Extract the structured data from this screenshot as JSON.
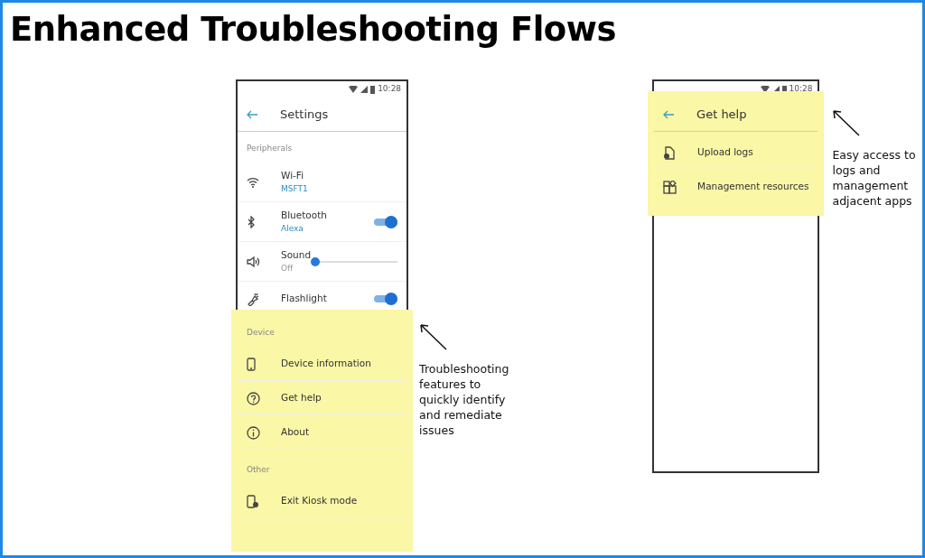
{
  "title": "Enhanced Troubleshooting Flows",
  "phones": [
    {
      "status_time": "10:28",
      "blocks": [
        {
          "kind": "header",
          "title": "Settings",
          "highlighted": false
        },
        {
          "kind": "section",
          "label": "Peripherals",
          "highlighted": false,
          "items": [
            {
              "kind": "text",
              "label": "Wi-Fi",
              "subtitle": "MSFT1",
              "accent": true
            },
            {
              "kind": "toggle",
              "label": "Bluetooth",
              "subtitle": "Alexa",
              "accent": true,
              "on": true
            },
            {
              "kind": "slider",
              "label": "Sound",
              "subtitle": "Off",
              "accent": false,
              "level": 0
            },
            {
              "kind": "toggle",
              "label": "Flashlight",
              "on": true
            }
          ]
        },
        {
          "kind": "section",
          "label": "Device",
          "highlighted": true,
          "items": [
            {
              "kind": "text",
              "label": "Device information"
            },
            {
              "kind": "text",
              "label": "Get help"
            },
            {
              "kind": "text",
              "label": "About"
            }
          ]
        },
        {
          "kind": "section",
          "label": "Other",
          "highlighted": true,
          "items": [
            {
              "kind": "text",
              "label": "Exit Kiosk mode"
            }
          ]
        }
      ]
    },
    {
      "status_time": "10:28",
      "blocks": [
        {
          "kind": "header",
          "title": "Get help",
          "highlighted": true
        },
        {
          "kind": "section",
          "highlighted": true,
          "items": [
            {
              "kind": "text",
              "label": "Upload logs"
            },
            {
              "kind": "text",
              "label": "Management resources"
            }
          ]
        }
      ]
    }
  ],
  "annotations": [
    "Troubleshooting features to quickly identify and remediate issues",
    "Easy access to logs and management adjacent apps"
  ]
}
